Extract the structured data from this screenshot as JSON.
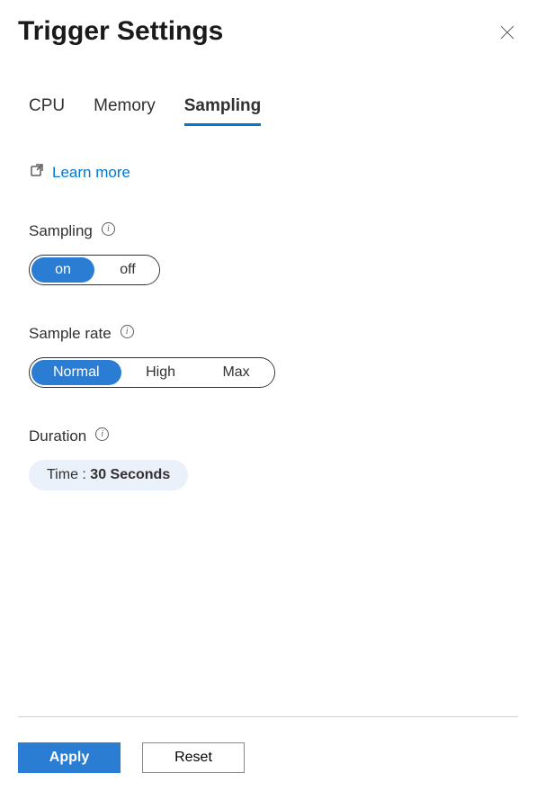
{
  "header": {
    "title": "Trigger Settings"
  },
  "tabs": {
    "cpu": "CPU",
    "memory": "Memory",
    "sampling": "Sampling"
  },
  "learn_more": {
    "label": "Learn more"
  },
  "sampling": {
    "label": "Sampling",
    "options": {
      "on": "on",
      "off": "off"
    },
    "selected": "on"
  },
  "sample_rate": {
    "label": "Sample rate",
    "options": {
      "normal": "Normal",
      "high": "High",
      "max": "Max"
    },
    "selected": "normal"
  },
  "duration": {
    "label": "Duration",
    "time_label": "Time : ",
    "value": "30 Seconds"
  },
  "footer": {
    "apply": "Apply",
    "reset": "Reset"
  }
}
